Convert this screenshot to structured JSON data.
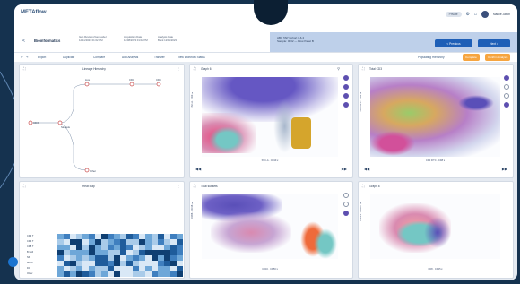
{
  "app": {
    "logo": "METAflow"
  },
  "header": {
    "user_name": "Marcie Jaxon",
    "plan_label": "Private"
  },
  "subheader": {
    "back": "<",
    "breadcrumb": "Bioinformatics",
    "meta": [
      {
        "label": "Gen Revision/Gen Label",
        "value": "12/11/2023 01:02 PM"
      },
      {
        "label": "Acquisition Date",
        "value": "12/08/2023 01:02 PM"
      },
      {
        "label": "Analysis Date",
        "value": "Bank 12/11/2023"
      }
    ],
    "study_box": {
      "line1": "ABC TAP Cohort 1 & 2",
      "line2": "Sample: 0032 — Flow Panel B"
    },
    "previous_button": "< Previous",
    "next_button": "Next >"
  },
  "toolbar": {
    "items": [
      "Export",
      "Duplicate",
      "Compare",
      "Add Analysis",
      "Transfer",
      "View Workflow Status"
    ],
    "right_label": "Populating Hierarchy",
    "orange_btn1": "Complete",
    "orange_btn2": "Confirm Analysis"
  },
  "panels": {
    "tree": {
      "title": "Lineage Hierarchy",
      "nodes": [
        "CD45",
        "Singlets",
        "Live",
        "CD3",
        "CD4",
        "Treg",
        "CD8",
        "Other"
      ]
    },
    "graph1": {
      "title": "Graph 6",
      "xlabel": "SSC-A · CD19 ▾",
      "ylabel": "FSC-A · CD3 ▾"
    },
    "graph2": {
      "title": "Total CD3",
      "xlabel": "CD4 FITC · CD8 ▾",
      "ylabel": "CD8 APC · CD4 ▾"
    },
    "heatmap": {
      "title": "Heat Map",
      "rows": [
        "CD3 T",
        "CD4 T",
        "CD8 T",
        "B Cell",
        "NK",
        "Mono",
        "DC",
        "Other"
      ]
    },
    "graph3": {
      "title": "Total subsets",
      "xlabel": "CD16 · CD56 ▾",
      "ylabel": "CD56 · CD16 ▾"
    },
    "graph4": {
      "title": "Graph 8",
      "xlabel": "CD8 · CD25 ▾",
      "ylabel": "FoxP3 · CD127 ▾"
    }
  },
  "colors": {
    "accent": "#1e5fb7",
    "orange": "#f6a540",
    "purple": "#5d4fb0"
  }
}
